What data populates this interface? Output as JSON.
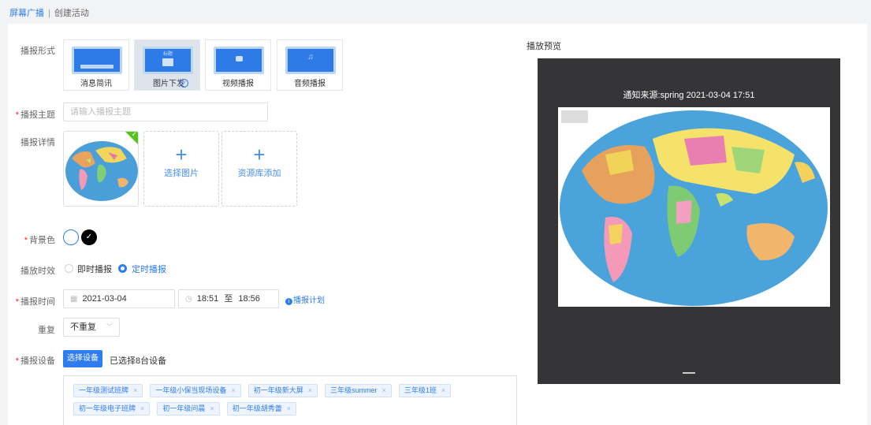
{
  "breadcrumb": {
    "parent": "屏幕广播",
    "separator": "|",
    "current": "创建活动"
  },
  "form": {
    "type_label": "播报形式",
    "types": [
      {
        "label": "消息简讯",
        "thumb_text": ""
      },
      {
        "label": "图片下发",
        "thumb_text": "标题"
      },
      {
        "label": "视频播报",
        "thumb_text": ""
      },
      {
        "label": "音频播报",
        "thumb_text": "♫"
      }
    ],
    "selected_type": "图片下发",
    "subject_label": "播报主题",
    "subject_placeholder": "请输入播报主题",
    "detail_label": "播报详情",
    "upload_image": "选择图片",
    "upload_library": "资源库添加",
    "bg_label": "背景色",
    "bg_colors": {
      "white": "#ffffff",
      "black": "#000000"
    },
    "effect_label": "播放时效",
    "effect_options": [
      "即时播报",
      "定时播报"
    ],
    "effect_selected": "定时播报",
    "time_label": "播报时间",
    "date_value": "2021-03-04",
    "time_start": "18:51",
    "time_to": "至",
    "time_end": "18:56",
    "plan_link": "播报计划",
    "repeat_label": "重复",
    "repeat_value": "不重复",
    "device_label": "播报设备",
    "device_button": "选择设备",
    "device_count": "已选择8台设备",
    "devices": [
      "一年级测试班牌",
      "一年级小保当现场设备",
      "初一年级新大屏",
      "三年级summer",
      "三年级1班",
      "初一年级电子班牌",
      "初一年级问晨",
      "初一年级胡秀蕾"
    ]
  },
  "preview": {
    "title": "播放预览",
    "header": "通知来源:spring   2021-03-04   17:51"
  },
  "colors": {
    "accent": "#2d7cf0",
    "required": "#f5222d",
    "preview_bg": "#353538"
  }
}
